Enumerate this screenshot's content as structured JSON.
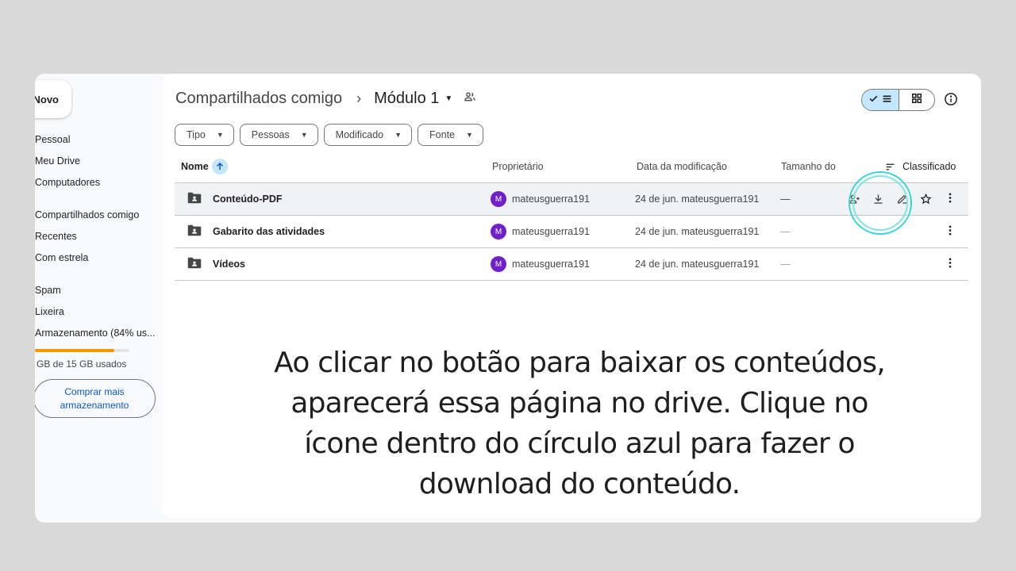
{
  "sidebar": {
    "new_label": "Novo",
    "items": [
      {
        "label": "Pessoal"
      },
      {
        "label": "Meu Drive"
      },
      {
        "label": "Computadores"
      },
      {
        "label": "Compartilhados comigo"
      },
      {
        "label": "Recentes"
      },
      {
        "label": "Com estrela"
      },
      {
        "label": "Spam"
      },
      {
        "label": "Lixeira"
      },
      {
        "label": "Armazenamento (84% us..."
      }
    ],
    "storage_used_fraction": 0.84,
    "storage_text": "GB de 15 GB usados",
    "buy_label_line1": "Comprar mais",
    "buy_label_line2": "armazenamento"
  },
  "header": {
    "breadcrumb_parent": "Compartilhados comigo",
    "breadcrumb_separator": "›",
    "breadcrumb_current": "Módulo 1",
    "view_mode": "list"
  },
  "filters": [
    {
      "label": "Tipo"
    },
    {
      "label": "Pessoas"
    },
    {
      "label": "Modificado"
    },
    {
      "label": "Fonte"
    }
  ],
  "columns": {
    "name": "Nome",
    "owner": "Proprietário",
    "modified": "Data da modificação",
    "size": "Tamanho do",
    "sort": "Classificado"
  },
  "rows": [
    {
      "name": "Conteúdo-PDF",
      "avatar": "M",
      "owner": "mateusguerra191",
      "modified": "24 de jun. mateusguerra191",
      "size": "—"
    },
    {
      "name": "Gabarito das atividades",
      "avatar": "M",
      "owner": "mateusguerra191",
      "modified": "24 de jun. mateusguerra191",
      "size": "—"
    },
    {
      "name": "Vídeos",
      "avatar": "M",
      "owner": "mateusguerra191",
      "modified": "24 de jun. mateusguerra191",
      "size": "—"
    }
  ],
  "caption": {
    "line1": "Ao clicar no botão para baixar os conteúdos,",
    "line2": "aparecerá essa página no drive. Clique no",
    "line3": "ícone dentro do círculo azul para fazer o",
    "line4": "download do conteúdo."
  },
  "colors": {
    "accent": "#c2e7ff",
    "avatar": "#6f20c9",
    "storage_fill": "#f29900",
    "highlight_ring": "#3ad4d8",
    "link": "#0b57d0"
  }
}
